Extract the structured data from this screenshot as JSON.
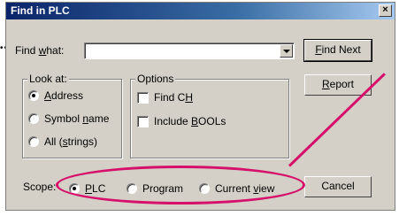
{
  "window": {
    "title": "Find in PLC",
    "close_glyph": "×"
  },
  "find_what": {
    "label_pre": "Find ",
    "label_u": "w",
    "label_post": "hat:",
    "value": ""
  },
  "buttons": {
    "find_next": {
      "u": "F",
      "rest": "ind Next"
    },
    "report": {
      "u": "R",
      "rest": "eport"
    },
    "cancel": "Cancel"
  },
  "look_at": {
    "title": "Look at:",
    "address": {
      "u": "A",
      "rest": "ddress",
      "checked": true
    },
    "symbol": {
      "pre": "Symbol ",
      "u": "n",
      "rest": "ame",
      "checked": false
    },
    "all": {
      "pre": "All (",
      "u": "s",
      "rest": "trings)",
      "checked": false
    }
  },
  "options": {
    "title": "Options",
    "find_ch": {
      "pre": "Find C",
      "u": "H",
      "checked": false
    },
    "include_bools": {
      "pre": "Include ",
      "u": "B",
      "rest": "OOLs",
      "checked": false
    }
  },
  "scope": {
    "label": "Scope:",
    "plc": {
      "u": "P",
      "rest": "LC",
      "checked": true
    },
    "program": {
      "text": "Program",
      "checked": false
    },
    "current_view": {
      "pre": "Current ",
      "u": "v",
      "rest": "iew",
      "checked": false
    }
  },
  "annotation": {
    "color": "#d6106a",
    "dots": "••"
  }
}
